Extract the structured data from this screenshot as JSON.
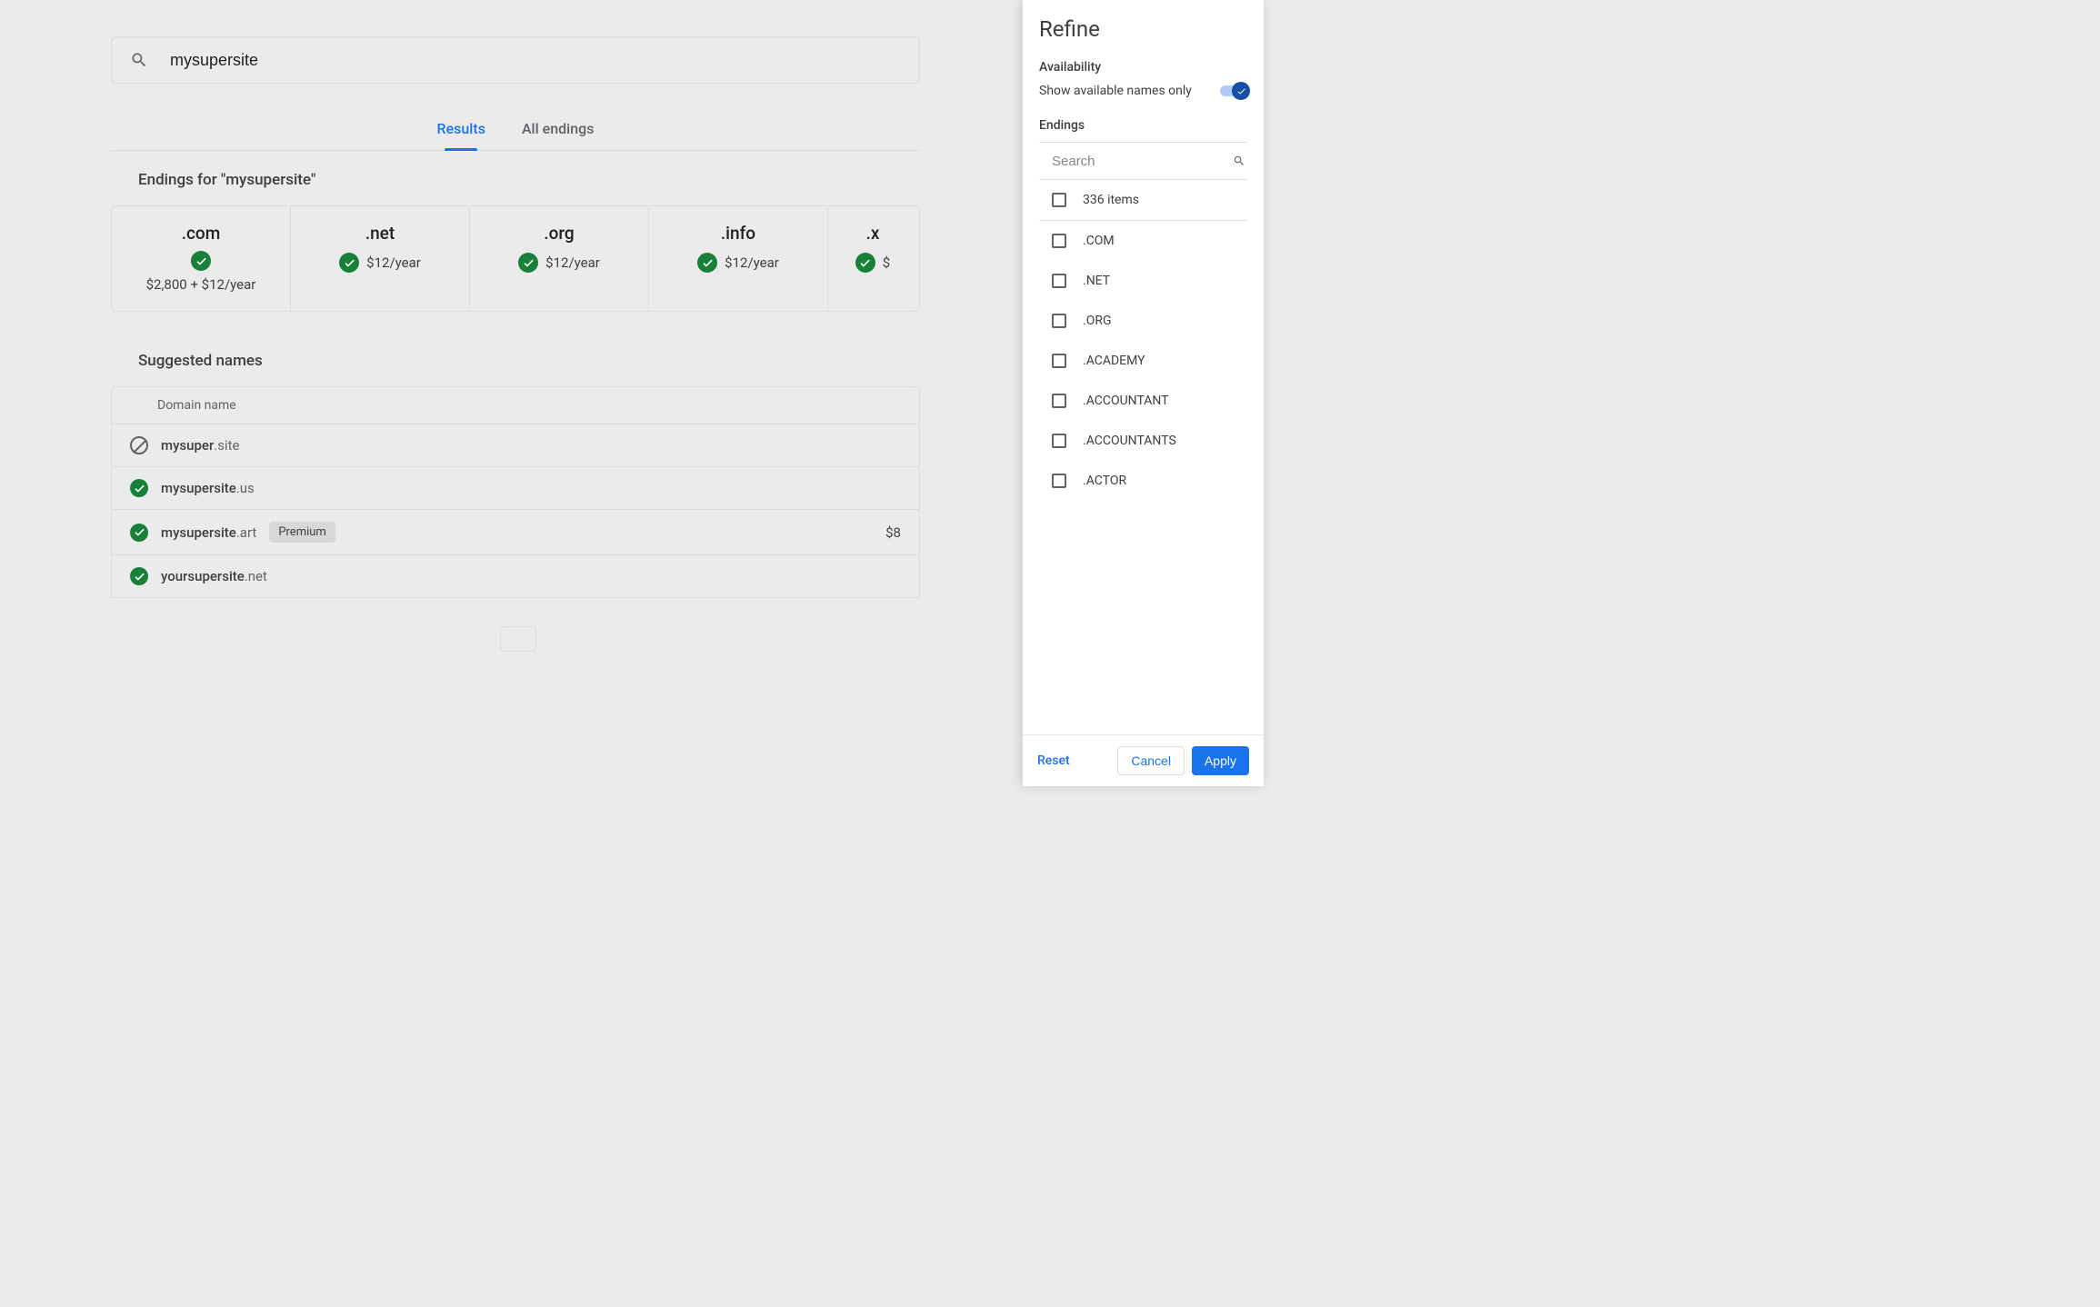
{
  "search": {
    "query": "mysupersite"
  },
  "tabs": {
    "results": "Results",
    "allEndings": "All endings"
  },
  "endingsHeading": "Endings for \"mysupersite\"",
  "endingCards": [
    {
      "tld": ".com",
      "price": "$2,800 + $12/year",
      "stacked": true
    },
    {
      "tld": ".net",
      "price": "$12/year",
      "stacked": false
    },
    {
      "tld": ".org",
      "price": "$12/year",
      "stacked": false
    },
    {
      "tld": ".info",
      "price": "$12/year",
      "stacked": false
    },
    {
      "tld": ".x",
      "price": "$",
      "stacked": false
    }
  ],
  "suggestedHeading": "Suggested names",
  "table": {
    "header": "Domain name",
    "rows": [
      {
        "status": "unavailable",
        "name": "mysuper",
        "tld": ".site",
        "badge": null,
        "priceStub": ""
      },
      {
        "status": "available",
        "name": "mysupersite",
        "tld": ".us",
        "badge": null,
        "priceStub": ""
      },
      {
        "status": "available",
        "name": "mysupersite",
        "tld": ".art",
        "badge": "Premium",
        "priceStub": "$8"
      },
      {
        "status": "available",
        "name": "yoursupersite",
        "tld": ".net",
        "badge": null,
        "priceStub": ""
      }
    ]
  },
  "refine": {
    "title": "Refine",
    "availabilityLabel": "Availability",
    "toggleText": "Show available names only",
    "endingsLabel": "Endings",
    "searchPlaceholder": "Search",
    "itemsCount": "336 items",
    "endingsList": [
      ".COM",
      ".NET",
      ".ORG",
      ".ACADEMY",
      ".ACCOUNTANT",
      ".ACCOUNTANTS",
      ".ACTOR"
    ],
    "reset": "Reset",
    "cancel": "Cancel",
    "apply": "Apply"
  }
}
